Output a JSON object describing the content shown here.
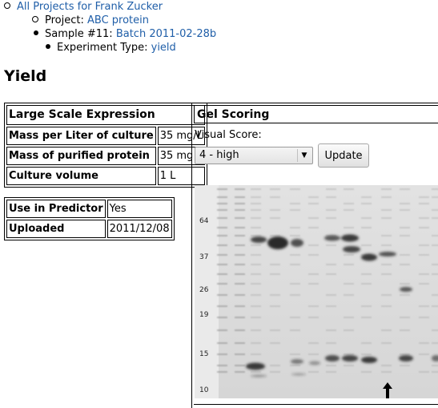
{
  "breadcrumb": {
    "level1_link": "All Projects for Frank Zucker",
    "level2_prefix": "Project: ",
    "level2_link": "ABC protein",
    "level3_prefix": "Sample #11: ",
    "level3_link": "Batch 2011-02-28b",
    "level4_prefix": "Experiment Type: ",
    "level4_link": "yield"
  },
  "page_title": "Yield",
  "expression_table": {
    "header": "Large Scale Expression",
    "rows": [
      {
        "label": "Mass per Liter of culture",
        "value": "35 mg/L"
      },
      {
        "label": "Mass of purified protein",
        "value": "35 mg"
      },
      {
        "label": "Culture volume",
        "value": "1 L"
      }
    ]
  },
  "predictor_table": {
    "rows": [
      {
        "label": "Use in Predictor",
        "value": "Yes"
      },
      {
        "label": "Uploaded",
        "value": "2011/12/08"
      }
    ]
  },
  "gel_scoring": {
    "header": "Gel Scoring",
    "visual_score_label": "Visual Score:",
    "selected_score": "4 - high",
    "update_label": "Update",
    "marker_labels": [
      "64",
      "37",
      "26",
      "19",
      "15",
      "10"
    ]
  }
}
